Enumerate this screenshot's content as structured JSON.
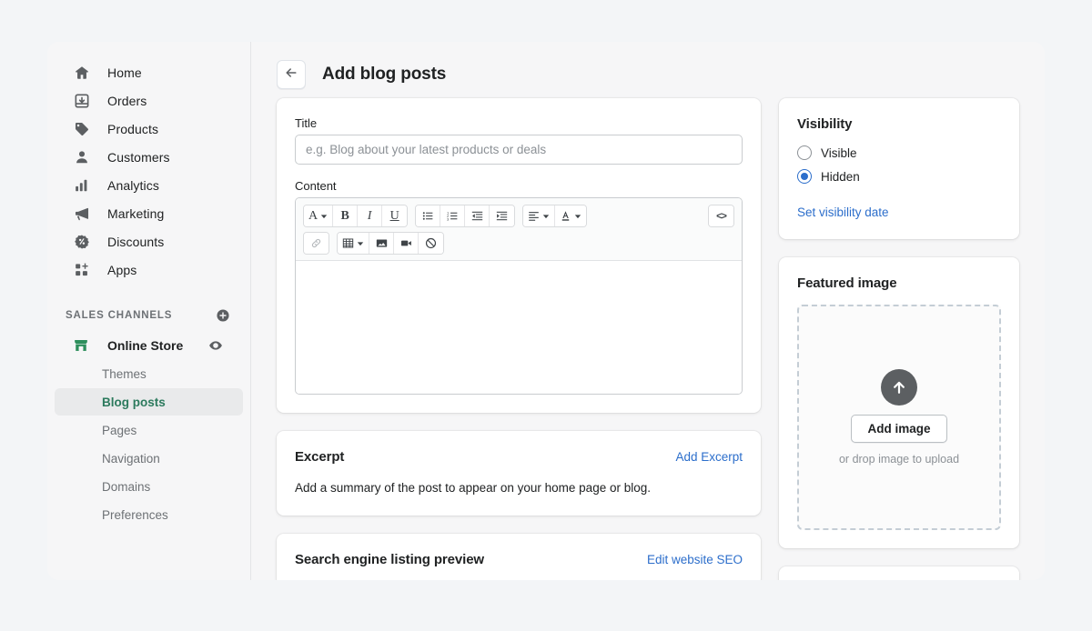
{
  "sidebar": {
    "nav": [
      {
        "label": "Home",
        "icon": "home-icon"
      },
      {
        "label": "Orders",
        "icon": "orders-inbox-icon"
      },
      {
        "label": "Products",
        "icon": "products-tag-icon"
      },
      {
        "label": "Customers",
        "icon": "customers-person-icon"
      },
      {
        "label": "Analytics",
        "icon": "analytics-bars-icon"
      },
      {
        "label": "Marketing",
        "icon": "marketing-megaphone-icon"
      },
      {
        "label": "Discounts",
        "icon": "discounts-badge-icon"
      },
      {
        "label": "Apps",
        "icon": "apps-grid-icon"
      }
    ],
    "section_title": "SALES CHANNELS",
    "add_channel_icon": "plus-circle-icon",
    "channel": {
      "label": "Online Store",
      "icon": "online-store-icon",
      "preview_icon": "eye-icon"
    },
    "sub_items": [
      {
        "label": "Themes",
        "active": false
      },
      {
        "label": "Blog posts",
        "active": true
      },
      {
        "label": "Pages",
        "active": false
      },
      {
        "label": "Navigation",
        "active": false
      },
      {
        "label": "Domains",
        "active": false
      },
      {
        "label": "Preferences",
        "active": false
      }
    ],
    "active_color": "#2c7a5d",
    "active_bg": "#e9eaeb"
  },
  "header": {
    "back_icon": "arrow-left-icon",
    "title": "Add blog posts"
  },
  "title_card": {
    "label": "Title",
    "placeholder": "e.g. Blog about your latest products or deals",
    "value": ""
  },
  "content_card": {
    "label": "Content",
    "body_value": "",
    "toolbar": {
      "row1": [
        {
          "name": "font-style-button",
          "glyph": "A",
          "caret": true,
          "serif": true
        },
        {
          "name": "bold-button",
          "glyph": "B",
          "caret": false,
          "serif": true
        },
        {
          "name": "italic-button",
          "glyph": "I",
          "caret": false,
          "serif": true
        },
        {
          "name": "underline-button",
          "glyph": "U",
          "caret": false,
          "serif": true
        }
      ],
      "row1b": [
        {
          "name": "bulleted-list-button"
        },
        {
          "name": "numbered-list-button"
        },
        {
          "name": "outdent-button"
        },
        {
          "name": "indent-button"
        }
      ],
      "row1c": [
        {
          "name": "align-left-button",
          "caret": true
        },
        {
          "name": "text-color-button",
          "caret": true
        }
      ],
      "code_button": {
        "name": "code-view-button",
        "glyph": "<>"
      },
      "row2": [
        {
          "name": "insert-link-button",
          "dim": true
        },
        {
          "name": "insert-table-button",
          "caret": true
        },
        {
          "name": "insert-image-button"
        },
        {
          "name": "insert-video-button"
        },
        {
          "name": "clear-formatting-button"
        }
      ]
    }
  },
  "excerpt_card": {
    "title": "Excerpt",
    "action": "Add Excerpt",
    "body": "Add a summary of the post to appear on your home page or blog."
  },
  "seo_card": {
    "title": "Search engine listing preview",
    "action": "Edit website SEO"
  },
  "visibility_card": {
    "title": "Visibility",
    "options": [
      {
        "label": "Visible",
        "selected": false
      },
      {
        "label": "Hidden",
        "selected": true
      }
    ],
    "link": "Set visibility date",
    "accent": "#2c6ecb"
  },
  "featured_image_card": {
    "title": "Featured image",
    "upload_icon": "upload-arrow-icon",
    "button": "Add image",
    "hint": "or drop image to upload"
  }
}
